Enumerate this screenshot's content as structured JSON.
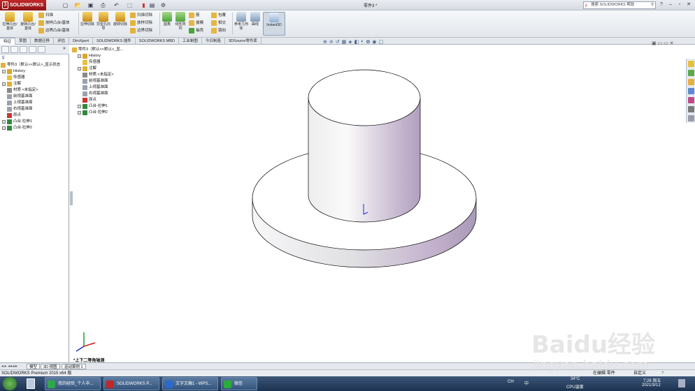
{
  "app": {
    "logo": "SOLIDWORKS",
    "document_title": "零件3 *"
  },
  "search": {
    "placeholder": "搜索 SOLIDWORKS 帮助"
  },
  "ribbon": {
    "boss_extrude": "拉伸凸台/基体",
    "revolve_boss": "旋转凸台/基体",
    "sweep": "扫描",
    "loft_boss": "放样凸台/基体",
    "boundary_boss": "边界凸台/基体",
    "cut_extrude": "拉伸切除",
    "hole_wizard": "异型孔向导",
    "revolve_cut": "旋转切除",
    "sweep_cut": "扫描切除",
    "loft_cut": "放样切除",
    "boundary_cut": "边界切除",
    "fillet": "圆角",
    "linear_pattern": "线性阵列",
    "rib": "筋",
    "draft": "拔模",
    "shell": "抽壳",
    "wrap": "包覆",
    "intersect": "相交",
    "mirror": "镜向",
    "ref_geometry": "参考几何体",
    "curves": "曲线",
    "instant3d": "Instant3D"
  },
  "tabs": [
    "特征",
    "草图",
    "数据迁移",
    "评估",
    "DimXpert",
    "SOLIDWORKS 插件",
    "SOLIDWORKS MBD",
    "工业制图",
    "今日制造",
    "3DSource零件库"
  ],
  "feature_tree_left": {
    "root": "零件3（默认<<默认>_显示状态",
    "items": [
      "History",
      "传感器",
      "注解",
      "材质 <未指定>",
      "前视基准面",
      "上视基准面",
      "右视基准面",
      "原点",
      "凸台-拉伸1",
      "凸台-拉伸2"
    ]
  },
  "feature_tree_view": {
    "root": "零件3（默认<<默认>_显...",
    "items": [
      "History",
      "传感器",
      "注解",
      "材质 <未指定>",
      "前视基准面",
      "上视基准面",
      "右视基准面",
      "原点",
      "凸台-拉伸1",
      "凸台-拉伸2"
    ]
  },
  "view": {
    "orientation_label": "*上下二等角轴测"
  },
  "model_tabs": [
    "模型",
    "3D 视图",
    "运动算例 1"
  ],
  "status": {
    "left": "SOLIDWORKS Premium 2015 x64 版",
    "editing": "在编辑 零件",
    "custom": "自定义"
  },
  "taskbar": {
    "items": [
      "我的经验_个人中...",
      "SOLIDWORKS P...",
      "文字文稿1 - WPS...",
      "微信"
    ],
    "temperature": "34°C",
    "cpu": "CPU温度",
    "ime": "中",
    "time": "7:26 周五",
    "date": "2021/3/12",
    "ch": "CH"
  },
  "watermark": {
    "brand": "Baidu经验",
    "url": "jingyan.baidu.com"
  },
  "colors": {
    "accent": "#c0282a",
    "cylinder_tint": "#b8a6c6"
  }
}
